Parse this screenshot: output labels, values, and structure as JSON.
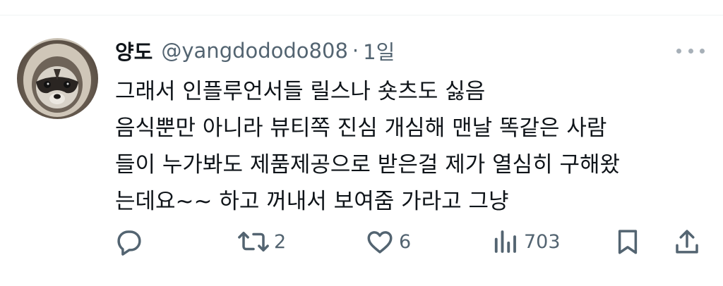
{
  "tweet": {
    "author_name": "양도",
    "author_handle": "@yangdododo808",
    "separator": "·",
    "time": "1일",
    "lines": [
      "그래서 인플루언서들 릴스나 숏츠도 싫음",
      "음식뿐만 아니라 뷰티쪽 진심 개심해 맨날 똑같은 사람",
      "들이 누가봐도 제품제공으로 받은걸 제가 열심히 구해왔",
      "는데요~~ 하고 꺼내서 보여줌 가라고 그냥"
    ]
  },
  "actions": {
    "reply_count": "",
    "retweet_count": "2",
    "like_count": "6",
    "views_count": "703"
  },
  "icons": {
    "avatar": "raccoon-avatar",
    "more": "more-dots-icon",
    "reply": "reply-icon",
    "retweet": "retweet-icon",
    "like": "heart-icon",
    "views": "views-icon",
    "bookmark": "bookmark-icon",
    "share": "share-icon"
  },
  "colors": {
    "text": "#0f1419",
    "secondary": "#536471",
    "divider": "#eff3f4"
  }
}
